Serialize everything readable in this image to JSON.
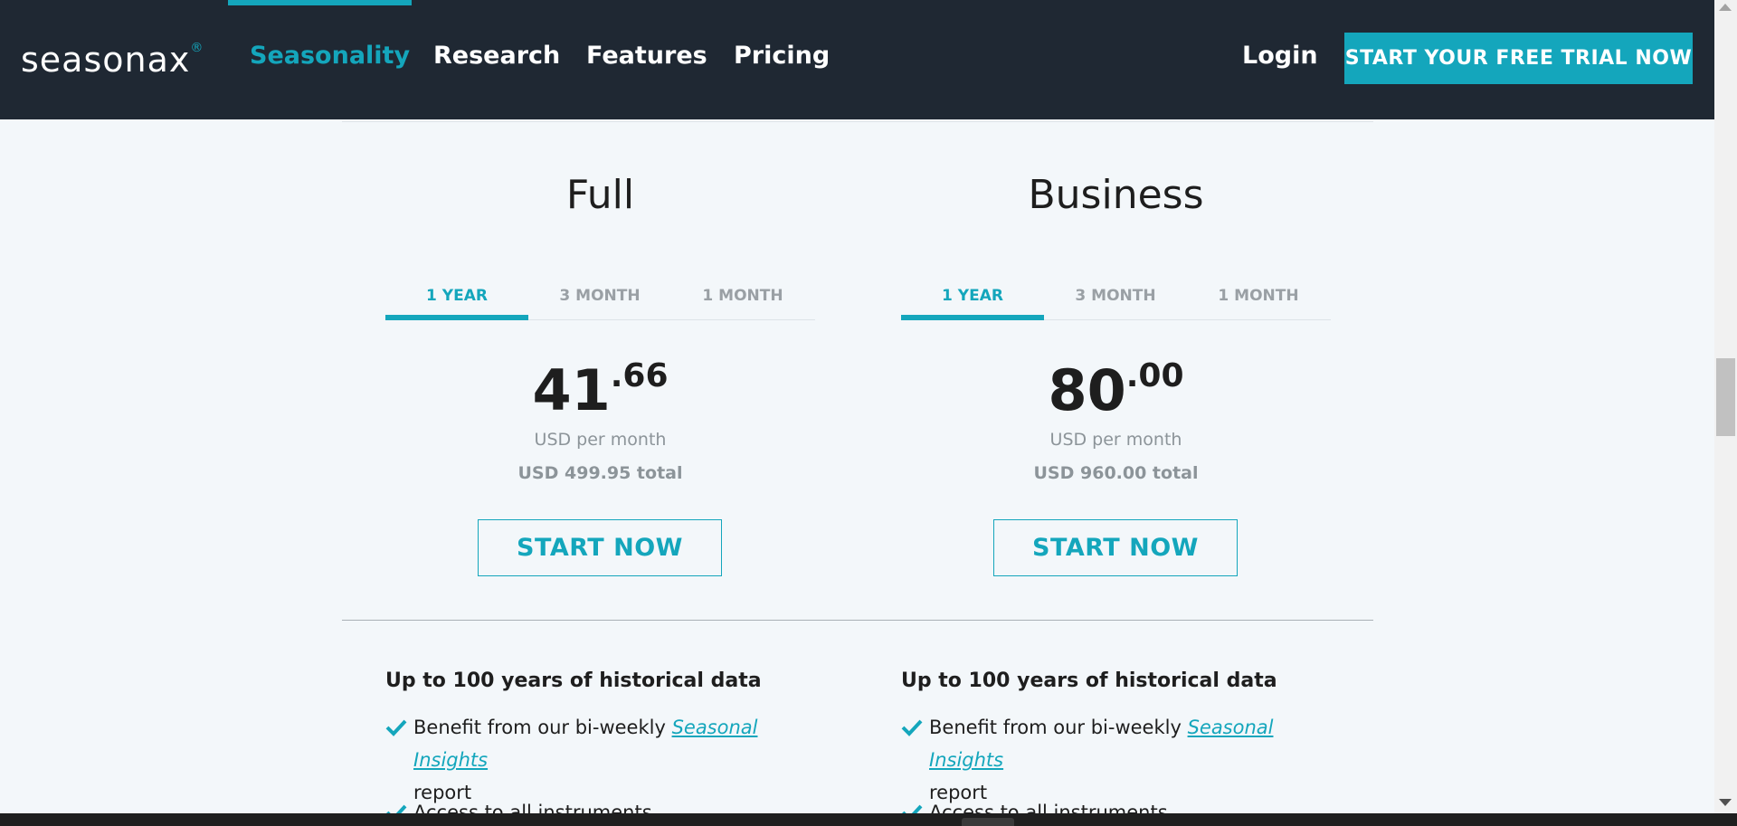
{
  "header": {
    "logo": "seasonax",
    "logo_mark": "®",
    "nav": [
      "Seasonality",
      "Research",
      "Features",
      "Pricing"
    ],
    "login": "Login",
    "trial_button": "START YOUR FREE TRIAL NOW"
  },
  "plans": [
    {
      "title": "Full",
      "tabs": [
        "1 YEAR",
        "3 MONTH",
        "1 MONTH"
      ],
      "price_whole": "41",
      "price_cents": ".66",
      "per_month": "USD per month",
      "total": "USD 499.95 total",
      "button": "START NOW",
      "features_heading": "Up to 100 years of historical data",
      "feature1_prefix": "Benefit from our bi-weekly ",
      "feature1_link": "Seasonal Insights",
      "feature1_suffix": "report",
      "feature2": "Access to all instruments"
    },
    {
      "title": "Business",
      "tabs": [
        "1 YEAR",
        "3 MONTH",
        "1 MONTH"
      ],
      "price_whole": "80",
      "price_cents": ".00",
      "per_month": "USD per month",
      "total": "USD 960.00 total",
      "button": "START NOW",
      "features_heading": "Up to 100 years of historical data",
      "feature1_prefix": "Benefit from our bi-weekly ",
      "feature1_link": "Seasonal Insights",
      "feature1_suffix": "report",
      "feature2": "Access to all instruments"
    }
  ],
  "colors": {
    "accent": "#14a6bc",
    "header_bg": "#1f2833",
    "page_bg": "#f3f7fa"
  }
}
